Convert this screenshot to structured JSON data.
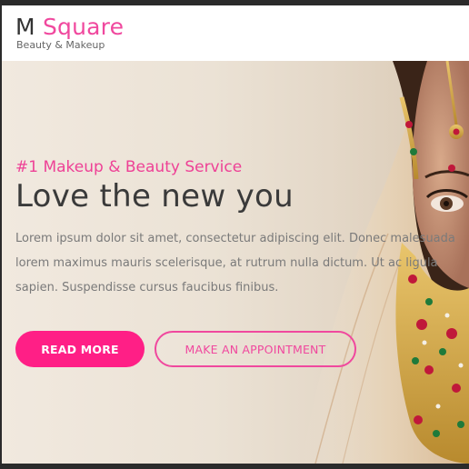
{
  "brand": {
    "name_first": "M",
    "name_second": "Square",
    "tagline": "Beauty & Makeup",
    "accent_color": "#f0489e"
  },
  "hero": {
    "eyebrow": "#1 Makeup & Beauty Service",
    "headline": "Love the new you",
    "body": "Lorem ipsum dolor sit amet, consectetur adipiscing elit. Donec malesuada lorem maximus mauris scelerisque, at rutrum nulla dictum. Ut ac ligula sapien. Suspendisse cursus faucibus finibus.",
    "primary_button": "READ MORE",
    "secondary_button": "MAKE AN APPOINTMENT",
    "primary_color": "#ff1f86"
  }
}
